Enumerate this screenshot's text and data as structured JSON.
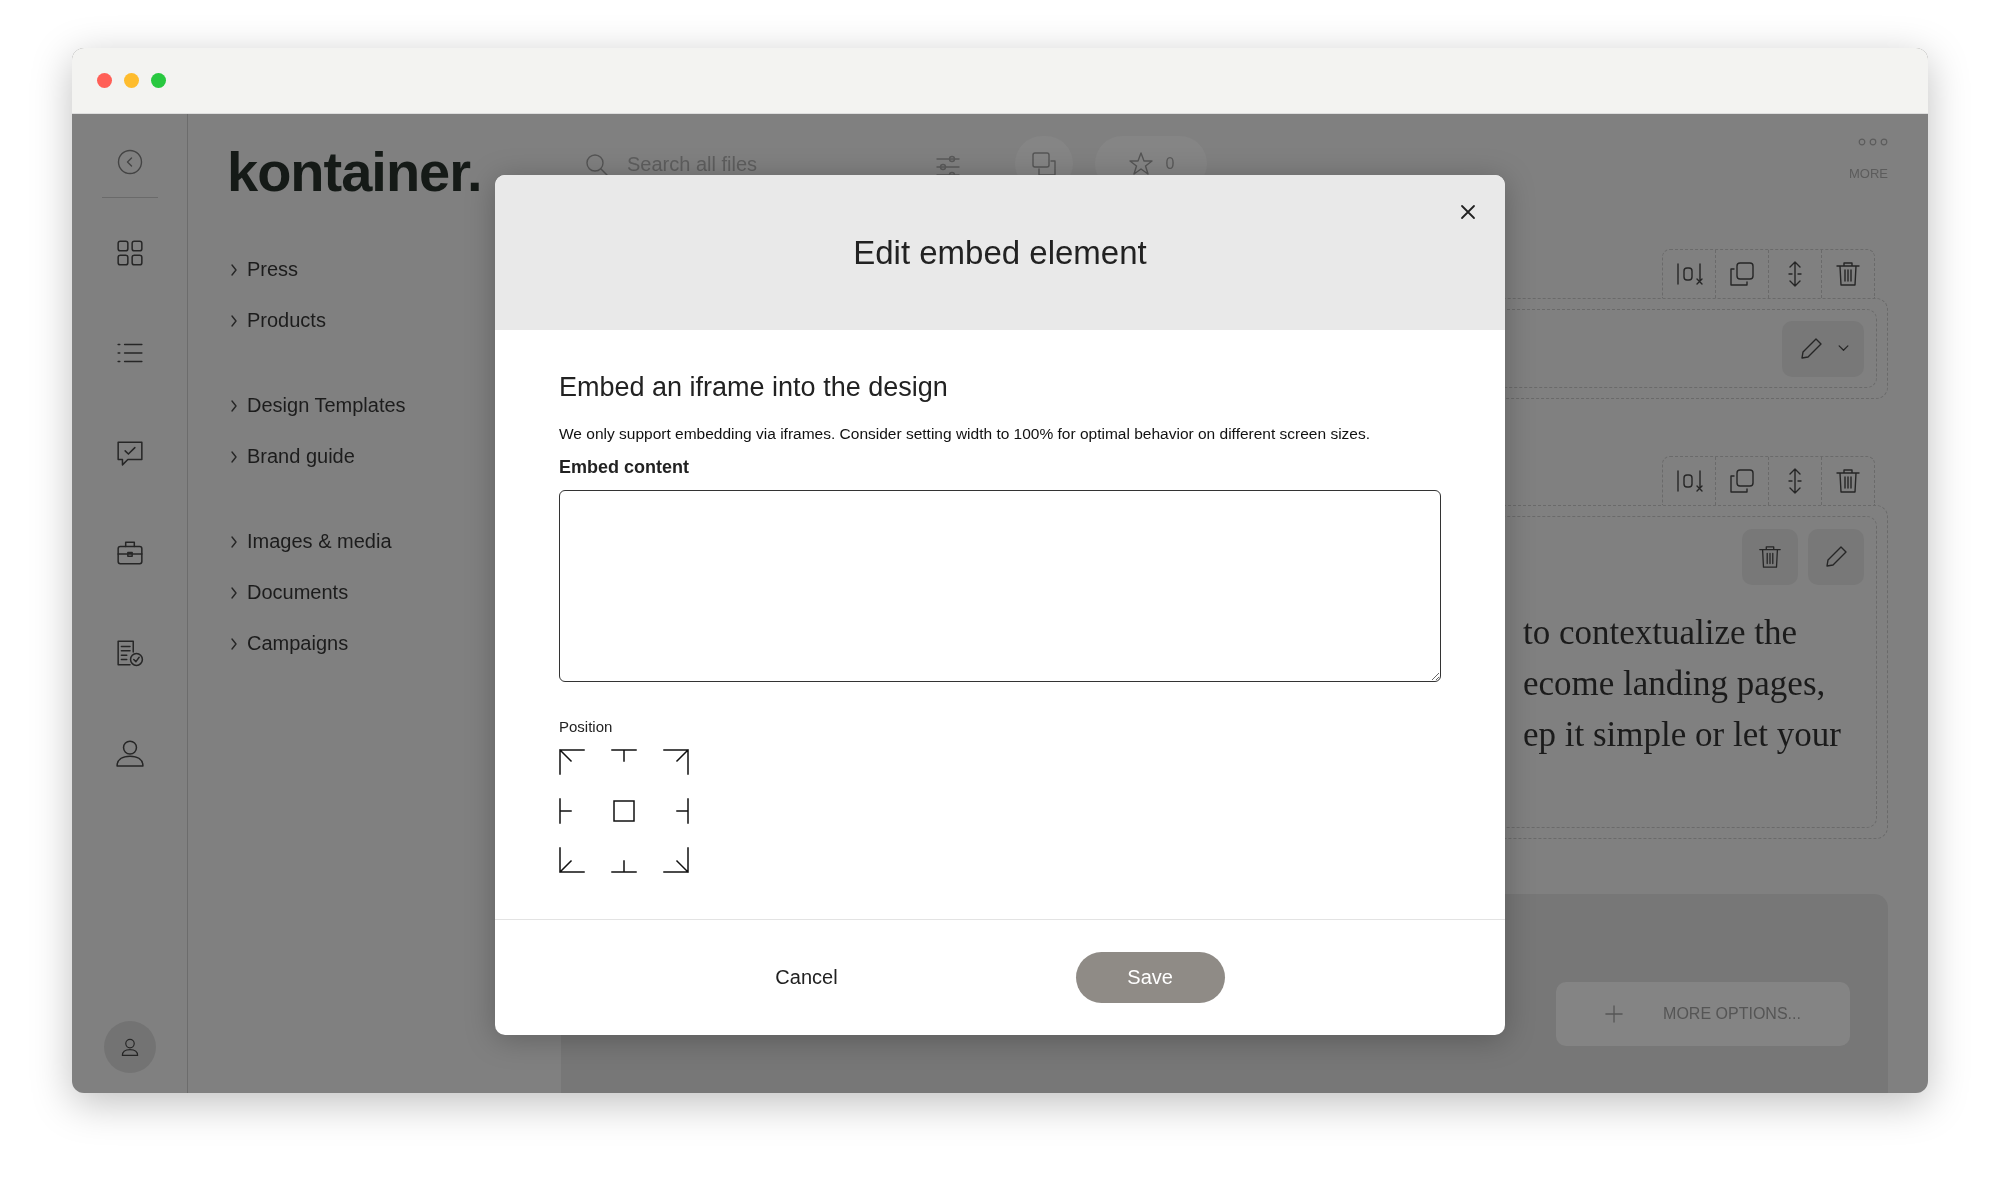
{
  "window": {
    "controls": [
      {
        "color": "#ff5f57"
      },
      {
        "color": "#febc2e"
      },
      {
        "color": "#28c840"
      }
    ]
  },
  "logo": "kontainer.",
  "search": {
    "placeholder": "Search all files"
  },
  "favorites": {
    "count": "0"
  },
  "more": {
    "label": "MORE"
  },
  "nav": {
    "groups": [
      [
        {
          "label": "Press"
        },
        {
          "label": "Products"
        }
      ],
      [
        {
          "label": "Design Templates"
        },
        {
          "label": "Brand guide"
        }
      ],
      [
        {
          "label": "Images & media"
        },
        {
          "label": "Documents"
        },
        {
          "label": "Campaigns"
        }
      ]
    ]
  },
  "canvas": {
    "text_lines": [
      "to contextualize the",
      "ecome landing pages,",
      "ep it simple or let your"
    ],
    "more_options": "MORE OPTIONS..."
  },
  "modal": {
    "title": "Edit embed element",
    "heading": "Embed an iframe into the design",
    "description": "We only support embedding via iframes. Consider setting width to 100% for optimal behavior on different screen sizes.",
    "field": {
      "label": "Embed content"
    },
    "position": {
      "label": "Position"
    },
    "cancel": {
      "label": "Cancel"
    },
    "save": {
      "label": "Save",
      "disabled": true
    }
  }
}
